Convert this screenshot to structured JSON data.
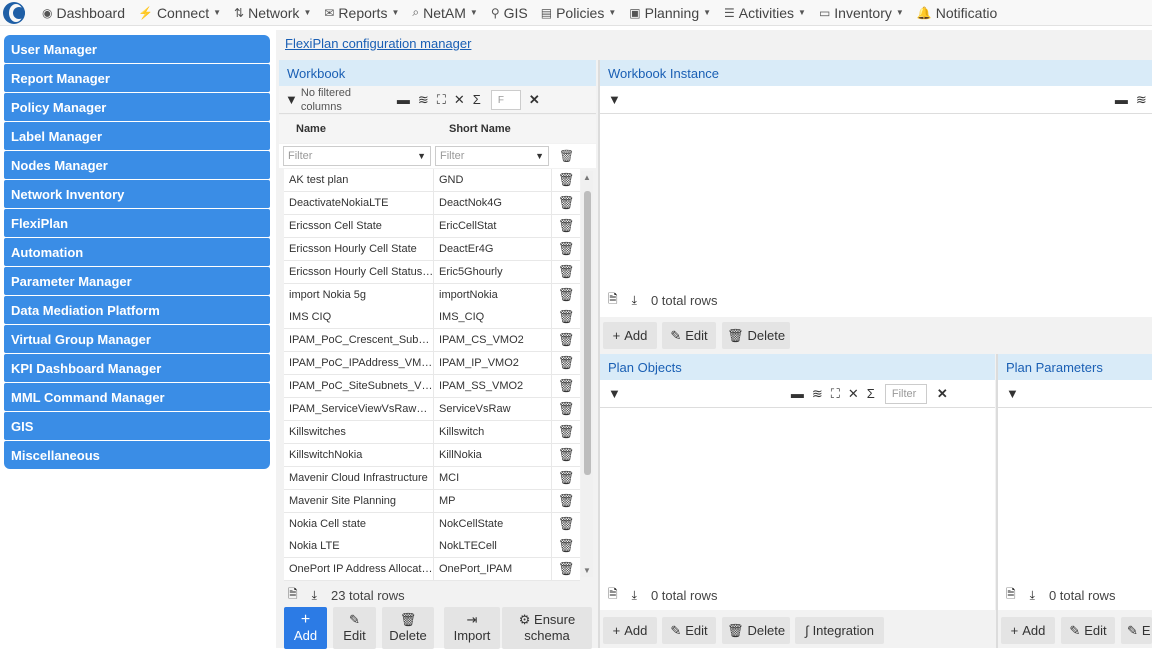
{
  "nav": [
    {
      "icon": "dashboard-icon",
      "glyph": "◉",
      "label": "Dashboard",
      "caret": false
    },
    {
      "icon": "connect-icon",
      "glyph": "⚡",
      "label": "Connect",
      "caret": true
    },
    {
      "icon": "network-icon",
      "glyph": "⇅",
      "label": "Network",
      "caret": true
    },
    {
      "icon": "reports-icon",
      "glyph": "✉",
      "label": "Reports",
      "caret": true
    },
    {
      "icon": "netam-icon",
      "glyph": "⌕",
      "label": "NetAM",
      "caret": true
    },
    {
      "icon": "gis-icon",
      "glyph": "⚲",
      "label": "GIS",
      "caret": false
    },
    {
      "icon": "policies-icon",
      "glyph": "▤",
      "label": "Policies",
      "caret": true
    },
    {
      "icon": "planning-icon",
      "glyph": "▣",
      "label": "Planning",
      "caret": true
    },
    {
      "icon": "activities-icon",
      "glyph": "☰",
      "label": "Activities",
      "caret": true
    },
    {
      "icon": "inventory-icon",
      "glyph": "▭",
      "label": "Inventory",
      "caret": true
    },
    {
      "icon": "notifications-icon",
      "glyph": "🔔",
      "label": "Notificatio",
      "caret": false
    }
  ],
  "sidebar": [
    "User Manager",
    "Report Manager",
    "Policy Manager",
    "Label Manager",
    "Nodes Manager",
    "Network Inventory",
    "FlexiPlan",
    "Automation",
    "Parameter Manager",
    "Data Mediation Platform",
    "Virtual Group Manager",
    "KPI Dashboard Manager",
    "MML Command Manager",
    "GIS",
    "Miscellaneous"
  ],
  "breadcrumb": "FlexiPlan configuration manager",
  "workbook": {
    "title": "Workbook",
    "filter_status": "No filtered columns",
    "search_placeholder": "F",
    "col_name": "Name",
    "col_short": "Short Name",
    "filter_placeholder": "Filter",
    "rows": [
      [
        "AK test plan",
        "GND"
      ],
      [
        "DeactivateNokiaLTE",
        "DeactNok4G"
      ],
      [
        "Ericsson Cell State",
        "EricCellStat"
      ],
      [
        "Ericsson Hourly Cell State",
        "DeactEr4G"
      ],
      [
        "Ericsson Hourly Cell Status…",
        "Eric5Ghourly"
      ],
      [
        "import Nokia 5g",
        "importNokia"
      ],
      [
        "IMS CIQ",
        "IMS_CIQ"
      ],
      [
        "IPAM_PoC_Crescent_Sub…",
        "IPAM_CS_VMO2"
      ],
      [
        "IPAM_PoC_IPAddress_VM…",
        "IPAM_IP_VMO2"
      ],
      [
        "IPAM_PoC_SiteSubnets_V…",
        "IPAM_SS_VMO2"
      ],
      [
        "IPAM_ServiceViewVsRaw…",
        "ServiceVsRaw"
      ],
      [
        "Killswitches",
        "Killswitch"
      ],
      [
        "KillswitchNokia",
        "KillNokia"
      ],
      [
        "Mavenir Cloud Infrastructure",
        "MCI"
      ],
      [
        "Mavenir Site Planning",
        "MP"
      ],
      [
        "Nokia Cell state",
        "NokCellState"
      ],
      [
        "Nokia LTE",
        "NokLTECell"
      ],
      [
        "OnePort IP Address Allocat…",
        "OnePort_IPAM"
      ]
    ],
    "total": "23 total rows",
    "btn_add": "Add",
    "btn_edit": "Edit",
    "btn_delete": "Delete",
    "btn_import": "Import",
    "btn_ensure_1": "Ensure",
    "btn_ensure_2": "schema"
  },
  "instance": {
    "title": "Workbook Instance",
    "total": "0 total rows",
    "btn_add": "Add",
    "btn_edit": "Edit",
    "btn_delete": "Delete"
  },
  "plan_objects": {
    "title": "Plan Objects",
    "search_placeholder": "Filter",
    "total": "0 total rows",
    "btn_add": "Add",
    "btn_edit": "Edit",
    "btn_delete": "Delete",
    "btn_integration": "Integration"
  },
  "plan_params": {
    "title": "Plan Parameters",
    "total": "0 total rows",
    "btn_add": "Add",
    "btn_edit": "Edit",
    "btn_partial": "E"
  }
}
